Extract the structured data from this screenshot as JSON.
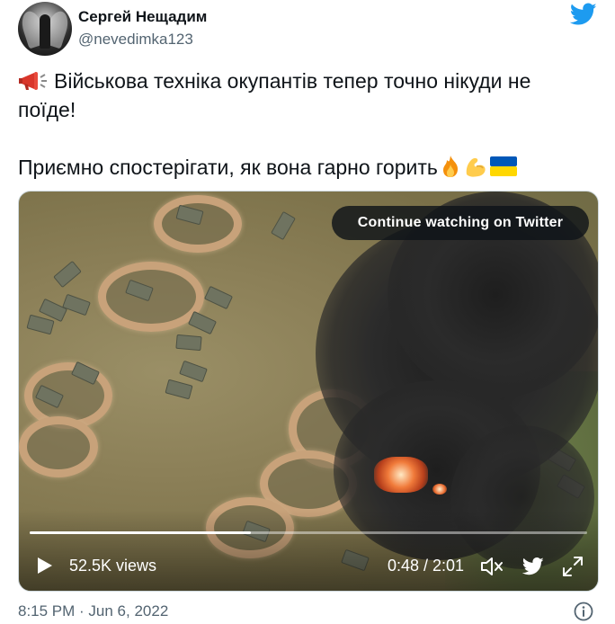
{
  "author": {
    "display_name": "Сергей Нещадим",
    "handle": "@nevedimka123"
  },
  "icons": {
    "twitter": "twitter-bird-icon",
    "megaphone": "megaphone-icon",
    "fire": "fire-emoji-icon",
    "flexed_biceps": "flexed-biceps-emoji-icon",
    "flag": "ukraine-flag-icon",
    "play": "play-icon",
    "volume": "volume-muted-icon",
    "fullscreen": "fullscreen-icon",
    "info": "info-icon"
  },
  "colors": {
    "twitter_blue": "#1d9bf0",
    "secondary_text": "#536471",
    "flag_blue": "#0057b8",
    "flag_yellow": "#ffd700"
  },
  "tweet": {
    "line1": "Військова техніка окупантів тепер точно нікуди не",
    "line2": "поїде!",
    "line3": "Приємно спостерігати, як вона гарно горить"
  },
  "video": {
    "continue_label": "Continue watching on Twitter",
    "views": "52.5K views",
    "time": "0:48 / 2:01",
    "progress": 0.397
  },
  "footer": {
    "timestamp": "8:15 PM · Jun 6, 2022"
  }
}
